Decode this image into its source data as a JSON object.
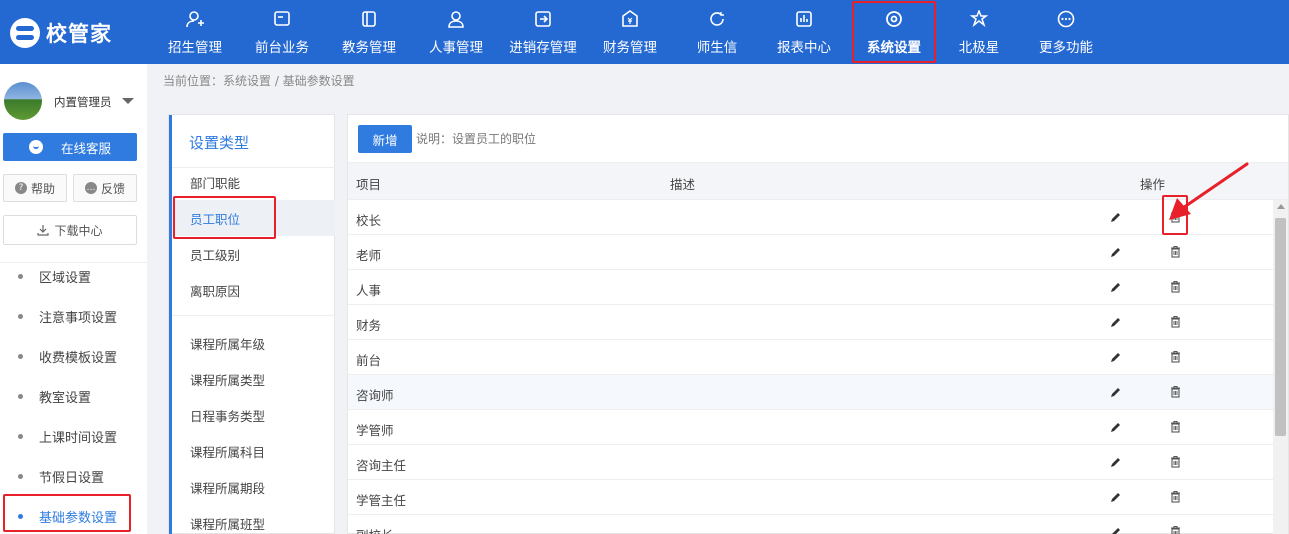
{
  "app": {
    "logo_text": "校管家"
  },
  "nav": [
    {
      "label": "招生管理",
      "icon": "user-add-icon"
    },
    {
      "label": "前台业务",
      "icon": "monitor-icon"
    },
    {
      "label": "教务管理",
      "icon": "book-icon"
    },
    {
      "label": "人事管理",
      "icon": "person-icon"
    },
    {
      "label": "进销存管理",
      "icon": "inventory-icon"
    },
    {
      "label": "财务管理",
      "icon": "finance-icon"
    },
    {
      "label": "师生信",
      "icon": "chat-icon"
    },
    {
      "label": "报表中心",
      "icon": "chart-icon"
    },
    {
      "label": "系统设置",
      "icon": "gear-icon",
      "active": true
    },
    {
      "label": "北极星",
      "icon": "star-icon"
    },
    {
      "label": "更多功能",
      "icon": "more-icon"
    }
  ],
  "user": {
    "name": "内置管理员"
  },
  "sidebar": {
    "service_label": "在线客服",
    "help_label": "帮助",
    "feedback_label": "反馈",
    "download_label": "下载中心",
    "menu": [
      {
        "label": "区域设置"
      },
      {
        "label": "注意事项设置"
      },
      {
        "label": "收费模板设置"
      },
      {
        "label": "教室设置"
      },
      {
        "label": "上课时间设置"
      },
      {
        "label": "节假日设置"
      },
      {
        "label": "基础参数设置",
        "active": true
      }
    ]
  },
  "breadcrumb": "当前位置：系统设置 / 基础参数设置",
  "type_panel": {
    "title": "设置类型",
    "group1": [
      "部门职能",
      "员工职位",
      "员工级别",
      "离职原因"
    ],
    "group2": [
      "课程所属年级",
      "课程所属类型",
      "日程事务类型",
      "课程所属科目",
      "课程所属期段",
      "课程所属班型"
    ],
    "active": "员工职位"
  },
  "content": {
    "add_label": "新增",
    "description": "说明：设置员工的职位",
    "columns": {
      "item": "项目",
      "desc": "描述",
      "ops": "操作"
    },
    "rows": [
      "校长",
      "老师",
      "人事",
      "财务",
      "前台",
      "咨询师",
      "学管师",
      "咨询主任",
      "学管主任",
      "副校长"
    ],
    "hover_row": "咨询师"
  },
  "colors": {
    "brand": "#2468d2",
    "accent": "#2f7be0",
    "highlight": "#e8202a"
  }
}
